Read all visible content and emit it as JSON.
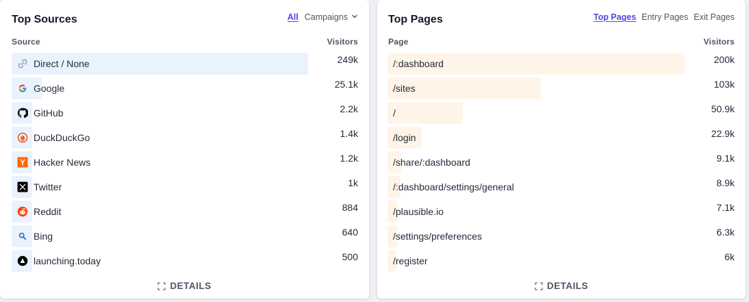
{
  "sources_card": {
    "title": "Top Sources",
    "tabs": {
      "all": "All",
      "campaigns": "Campaigns"
    },
    "col_left": "Source",
    "col_right": "Visitors",
    "details": "DETAILS",
    "max_visitors": 249000,
    "rows": [
      {
        "label": "Direct / None",
        "value": "249k",
        "visitors": 249000,
        "icon": "link-icon"
      },
      {
        "label": "Google",
        "value": "25.1k",
        "visitors": 25100,
        "icon": "google-icon"
      },
      {
        "label": "GitHub",
        "value": "2.2k",
        "visitors": 2200,
        "icon": "github-icon"
      },
      {
        "label": "DuckDuckGo",
        "value": "1.4k",
        "visitors": 1400,
        "icon": "duckduckgo-icon"
      },
      {
        "label": "Hacker News",
        "value": "1.2k",
        "visitors": 1200,
        "icon": "hacker-news-icon"
      },
      {
        "label": "Twitter",
        "value": "1k",
        "visitors": 1000,
        "icon": "x-icon"
      },
      {
        "label": "Reddit",
        "value": "884",
        "visitors": 884,
        "icon": "reddit-icon"
      },
      {
        "label": "Bing",
        "value": "640",
        "visitors": 640,
        "icon": "bing-icon"
      },
      {
        "label": "launching.today",
        "value": "500",
        "visitors": 500,
        "icon": "launching-today-icon"
      }
    ]
  },
  "pages_card": {
    "title": "Top Pages",
    "tabs": {
      "top": "Top Pages",
      "entry": "Entry Pages",
      "exit": "Exit Pages"
    },
    "col_left": "Page",
    "col_right": "Visitors",
    "details": "DETAILS",
    "max_visitors": 200000,
    "rows": [
      {
        "label": "/:dashboard",
        "value": "200k",
        "visitors": 200000
      },
      {
        "label": "/sites",
        "value": "103k",
        "visitors": 103000
      },
      {
        "label": "/",
        "value": "50.9k",
        "visitors": 50900
      },
      {
        "label": "/login",
        "value": "22.9k",
        "visitors": 22900
      },
      {
        "label": "/share/:dashboard",
        "value": "9.1k",
        "visitors": 9100
      },
      {
        "label": "/:dashboard/settings/general",
        "value": "8.9k",
        "visitors": 8900
      },
      {
        "label": "/plausible.io",
        "value": "7.1k",
        "visitors": 7100
      },
      {
        "label": "/settings/preferences",
        "value": "6.3k",
        "visitors": 6300
      },
      {
        "label": "/register",
        "value": "6k",
        "visitors": 6000
      }
    ]
  },
  "colors": {
    "accent": "#4f46e5",
    "source_bar": "#eaf2fd",
    "page_bar": "#fff4e8"
  }
}
